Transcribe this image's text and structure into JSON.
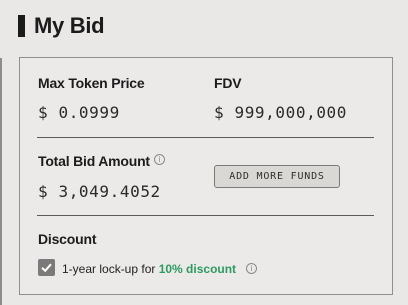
{
  "header": {
    "title": "My Bid"
  },
  "bid": {
    "max_token_price": {
      "label": "Max Token Price",
      "value": "$ 0.0999"
    },
    "fdv": {
      "label": "FDV",
      "value": "$ 999,000,000"
    },
    "total_bid": {
      "label": "Total Bid Amount",
      "value": "$ 3,049.4052"
    },
    "add_funds_label": "ADD MORE FUNDS"
  },
  "discount": {
    "label": "Discount",
    "checked": true,
    "option_text": "1-year lock-up for ",
    "option_highlight": "10% discount"
  },
  "colors": {
    "accent_green": "#2d9a62",
    "checkbox_fill": "#7a7a7a"
  },
  "icons": [
    "info-icon",
    "checkmark-icon"
  ]
}
